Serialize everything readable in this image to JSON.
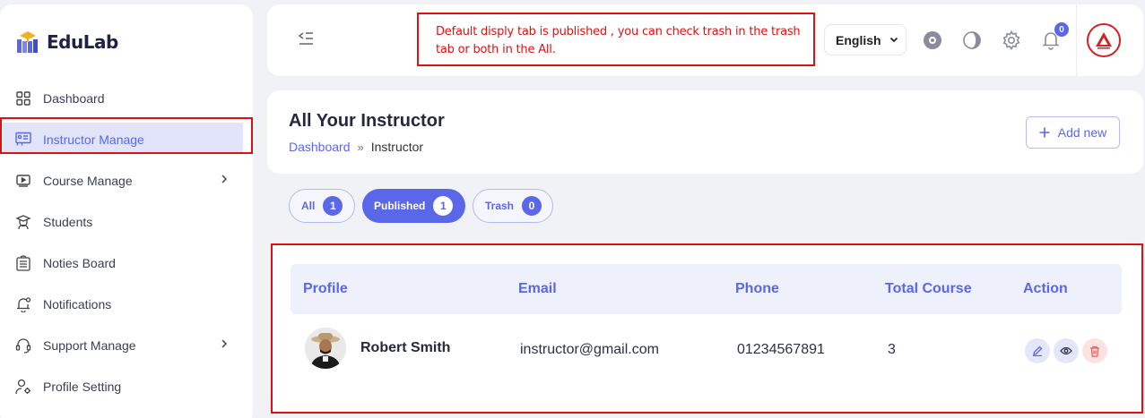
{
  "brand": {
    "name": "EduLab"
  },
  "sidebar": {
    "items": [
      {
        "label": "Dashboard",
        "icon": "grid-icon"
      },
      {
        "label": "Instructor Manage",
        "icon": "instructor-icon"
      },
      {
        "label": "Course Manage",
        "icon": "video-icon"
      },
      {
        "label": "Students",
        "icon": "student-icon"
      },
      {
        "label": "Noties Board",
        "icon": "notice-icon"
      },
      {
        "label": "Notifications",
        "icon": "bell-icon"
      },
      {
        "label": "Support Manage",
        "icon": "headset-icon"
      },
      {
        "label": "Profile Setting",
        "icon": "user-gear-icon"
      }
    ]
  },
  "header": {
    "note_line1": "Default  disply tab is published , you can check trash in the trash",
    "note_line2": "tab or both in the All.",
    "language": "English",
    "notification_count": "0"
  },
  "page": {
    "title": "All Your Instructor",
    "breadcrumb_home": "Dashboard",
    "breadcrumb_sep": "»",
    "breadcrumb_current": "Instructor",
    "add_label": "Add new"
  },
  "tabs": [
    {
      "label": "All",
      "count": "1"
    },
    {
      "label": "Published",
      "count": "1"
    },
    {
      "label": "Trash",
      "count": "0"
    }
  ],
  "table": {
    "headers": [
      "Profile",
      "Email",
      "Phone",
      "Total Course",
      "Action"
    ],
    "rows": [
      {
        "name": "Robert Smith",
        "email": "instructor@gmail.com",
        "phone": "01234567891",
        "total_course": "3"
      }
    ]
  },
  "colors": {
    "accent": "#5a67e8",
    "highlight": "#e01010",
    "danger": "#f05a5a"
  }
}
